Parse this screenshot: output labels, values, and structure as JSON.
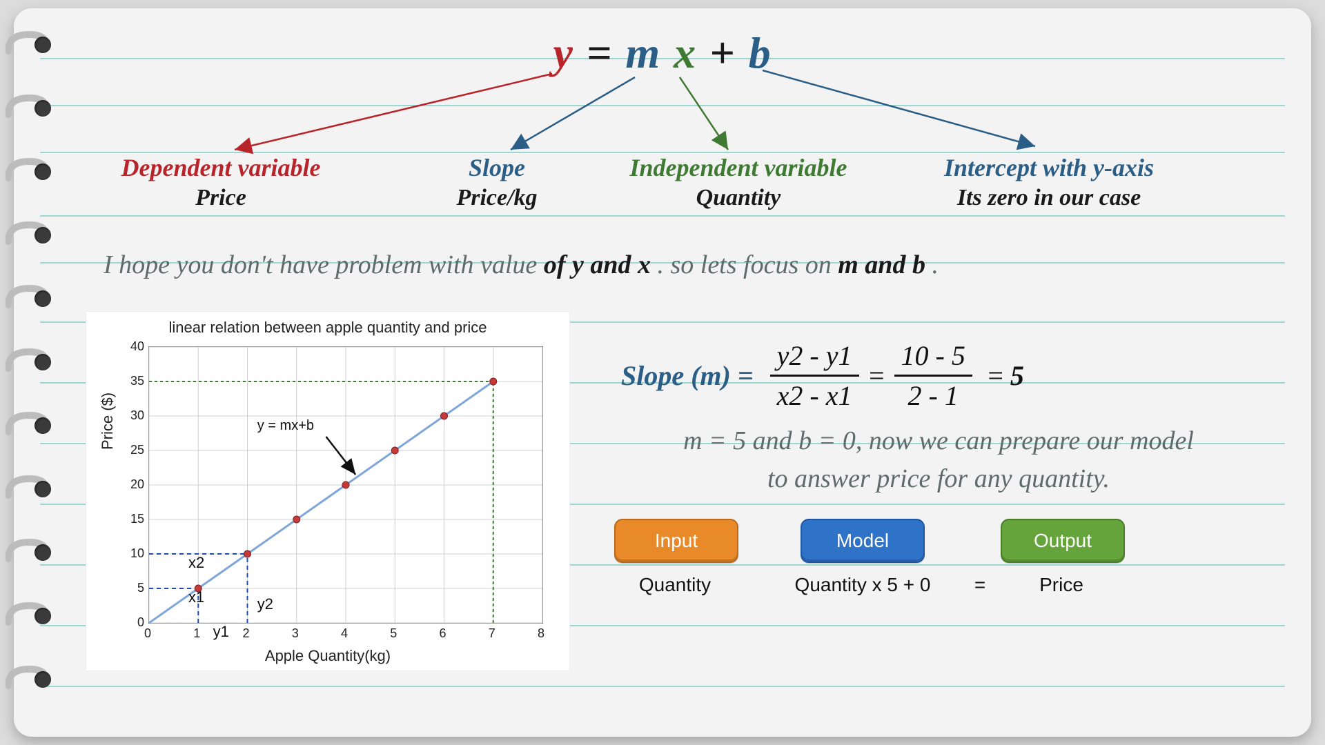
{
  "equation": {
    "y": "y",
    "eq": " = ",
    "m": "m",
    "x": "x",
    "plus": " + ",
    "b": "b"
  },
  "labels": {
    "dep": {
      "title": "Dependent variable",
      "sub": "Price"
    },
    "slope": {
      "title": "Slope",
      "sub": "Price/kg"
    },
    "ind": {
      "title": "Independent variable",
      "sub": "Quantity"
    },
    "int": {
      "title": "Intercept with y-axis",
      "sub": "Its zero in our case"
    }
  },
  "note1": {
    "a": "I hope you don't have problem with value ",
    "b": "of y and x",
    "c": ". so lets focus on ",
    "d": "m and b",
    "e": "."
  },
  "slope_math": {
    "lhs": "Slope (m) =",
    "num1": "y2 - y1",
    "den1": "x2 - x1",
    "eq1": "=",
    "num2": "10 - 5",
    "den2": "2 - 1",
    "eq2": "=",
    "res": "5"
  },
  "note2": {
    "a": "m = 5 and b = 0, now we can prepare our model",
    "b": "to answer price for any quantity."
  },
  "pills": {
    "input": {
      "title": "Input",
      "sub": "Quantity"
    },
    "model": {
      "title": "Model",
      "sub": "Quantity x 5 + 0"
    },
    "output": {
      "title": "Output",
      "sub": "Price"
    },
    "equals": "="
  },
  "chart_data": {
    "type": "line",
    "title": "linear relation between apple quantity and price",
    "xlabel": "Apple Quantity(kg)",
    "ylabel": "Price ($)",
    "xlim": [
      0,
      8
    ],
    "ylim": [
      0,
      40
    ],
    "xticks": [
      0,
      1,
      2,
      3,
      4,
      5,
      6,
      7,
      8
    ],
    "yticks": [
      0,
      5,
      10,
      15,
      20,
      25,
      30,
      35,
      40
    ],
    "series": [
      {
        "name": "y = mx+b",
        "x": [
          0,
          1,
          2,
          3,
          4,
          5,
          6,
          7
        ],
        "y": [
          0,
          5,
          10,
          15,
          20,
          25,
          30,
          35
        ],
        "markers": true
      }
    ],
    "annotations": {
      "line_label": "y = mx+b",
      "x1": "x1",
      "x2": "x2",
      "y1": "y1",
      "y2": "y2",
      "dashed_blue": [
        {
          "from_x": 0,
          "from_y": 5,
          "to_x": 1,
          "to_y": 5
        },
        {
          "from_x": 1,
          "from_y": 0,
          "to_x": 1,
          "to_y": 5
        },
        {
          "from_x": 0,
          "from_y": 10,
          "to_x": 2,
          "to_y": 10
        },
        {
          "from_x": 2,
          "from_y": 0,
          "to_x": 2,
          "to_y": 10
        }
      ],
      "dashed_green": [
        {
          "from_x": 0,
          "from_y": 35,
          "to_x": 7,
          "to_y": 35
        },
        {
          "from_x": 7,
          "from_y": 0,
          "to_x": 7,
          "to_y": 35
        }
      ]
    }
  }
}
